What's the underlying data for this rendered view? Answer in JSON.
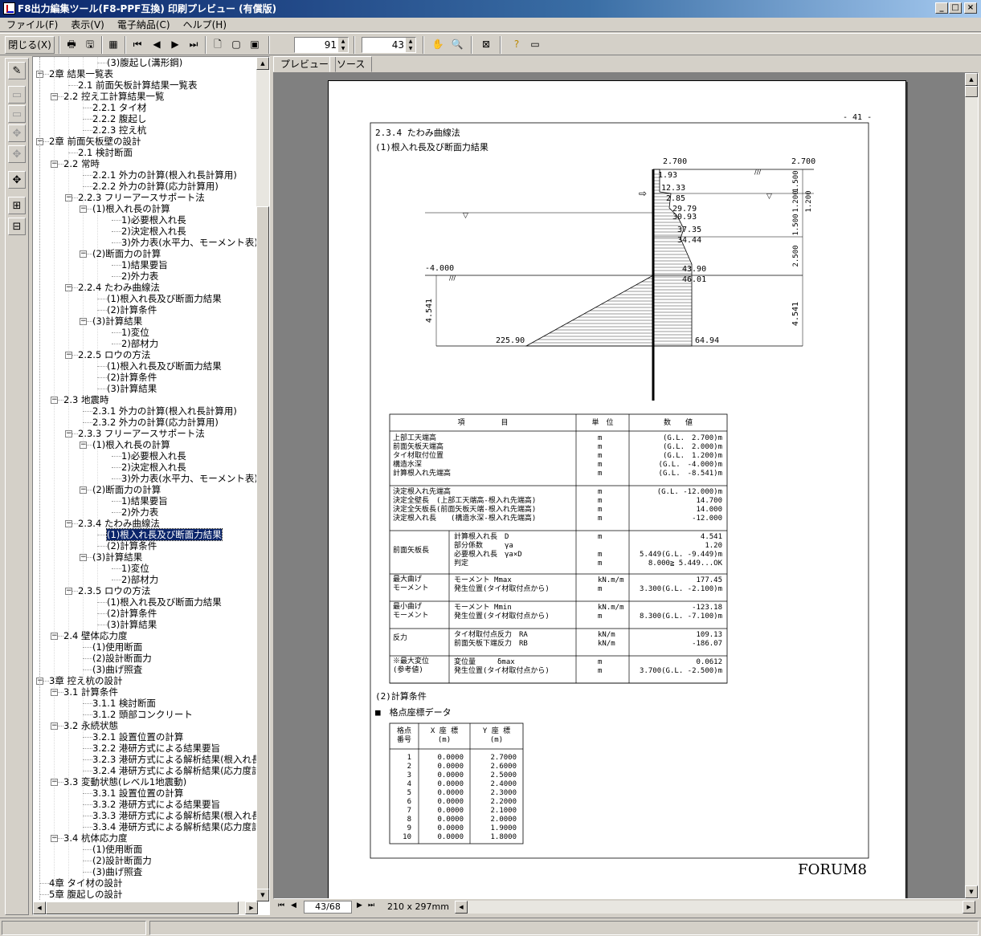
{
  "window": {
    "title": "F8出力編集ツール(F8-PPF互換) 印刷プレビュー (有償版)"
  },
  "menu": [
    "ファイル(F)",
    "表示(V)",
    "電子納品(C)",
    "ヘルプ(H)"
  ],
  "toolbar": {
    "close_label": "閉じる(X)",
    "zoom_value": "91",
    "page_value": "43"
  },
  "tabs": [
    "プレビュー",
    "ソース"
  ],
  "tree": [
    {
      "label": "(3)腹起し(溝形鋼)",
      "level": 4
    },
    {
      "label": "2章 結果一覧表",
      "level": 0
    },
    {
      "label": "2.1 前面矢板計算結果一覧表",
      "level": 2
    },
    {
      "label": "2.2 控え工計算結果一覧",
      "level": 1
    },
    {
      "label": "2.2.1 タイ材",
      "level": 3
    },
    {
      "label": "2.2.2 腹起し",
      "level": 3
    },
    {
      "label": "2.2.3 控え杭",
      "level": 3
    },
    {
      "label": "2章 前面矢板壁の設計",
      "level": 0
    },
    {
      "label": "2.1 検討断面",
      "level": 2
    },
    {
      "label": "2.2 常時",
      "level": 1
    },
    {
      "label": "2.2.1 外力の計算(根入れ長計算用)",
      "level": 3
    },
    {
      "label": "2.2.2 外力の計算(応力計算用)",
      "level": 3
    },
    {
      "label": "2.2.3 フリーアースサポート法",
      "level": 2
    },
    {
      "label": "(1)根入れ長の計算",
      "level": 3
    },
    {
      "label": "1)必要根入れ長",
      "level": 5
    },
    {
      "label": "2)決定根入れ長",
      "level": 5
    },
    {
      "label": "3)外力表(水平力、モーメント表)",
      "level": 5
    },
    {
      "label": "(2)断面力の計算",
      "level": 3
    },
    {
      "label": "1)結果要旨",
      "level": 5
    },
    {
      "label": "2)外力表",
      "level": 5
    },
    {
      "label": "2.2.4 たわみ曲線法",
      "level": 2
    },
    {
      "label": "(1)根入れ長及び断面力結果",
      "level": 4
    },
    {
      "label": "(2)計算条件",
      "level": 4
    },
    {
      "label": "(3)計算結果",
      "level": 3
    },
    {
      "label": "1)変位",
      "level": 5
    },
    {
      "label": "2)部材力",
      "level": 5
    },
    {
      "label": "2.2.5 ロウの方法",
      "level": 2
    },
    {
      "label": "(1)根入れ長及び断面力結果",
      "level": 4
    },
    {
      "label": "(2)計算条件",
      "level": 4
    },
    {
      "label": "(3)計算結果",
      "level": 4
    },
    {
      "label": "2.3 地震時",
      "level": 1
    },
    {
      "label": "2.3.1 外力の計算(根入れ長計算用)",
      "level": 3
    },
    {
      "label": "2.3.2 外力の計算(応力計算用)",
      "level": 3
    },
    {
      "label": "2.3.3 フリーアースサポート法",
      "level": 2
    },
    {
      "label": "(1)根入れ長の計算",
      "level": 3
    },
    {
      "label": "1)必要根入れ長",
      "level": 5
    },
    {
      "label": "2)決定根入れ長",
      "level": 5
    },
    {
      "label": "3)外力表(水平力、モーメント表)",
      "level": 5
    },
    {
      "label": "(2)断面力の計算",
      "level": 3
    },
    {
      "label": "1)結果要旨",
      "level": 5
    },
    {
      "label": "2)外力表",
      "level": 5
    },
    {
      "label": "2.3.4 たわみ曲線法",
      "level": 2
    },
    {
      "label": "(1)根入れ長及び断面力結果",
      "level": 4,
      "selected": true
    },
    {
      "label": "(2)計算条件",
      "level": 4
    },
    {
      "label": "(3)計算結果",
      "level": 3
    },
    {
      "label": "1)変位",
      "level": 5
    },
    {
      "label": "2)部材力",
      "level": 5
    },
    {
      "label": "2.3.5 ロウの方法",
      "level": 2
    },
    {
      "label": "(1)根入れ長及び断面力結果",
      "level": 4
    },
    {
      "label": "(2)計算条件",
      "level": 4
    },
    {
      "label": "(3)計算結果",
      "level": 4
    },
    {
      "label": "2.4 壁体応力度",
      "level": 1
    },
    {
      "label": "(1)使用断面",
      "level": 3
    },
    {
      "label": "(2)設計断面力",
      "level": 3
    },
    {
      "label": "(3)曲げ照査",
      "level": 3
    },
    {
      "label": "3章 控え杭の設計",
      "level": 0
    },
    {
      "label": "3.1 計算条件",
      "level": 1
    },
    {
      "label": "3.1.1 検討断面",
      "level": 3
    },
    {
      "label": "3.1.2 頭部コンクリート",
      "level": 3
    },
    {
      "label": "3.2 永続状態",
      "level": 1
    },
    {
      "label": "3.2.1 設置位置の計算",
      "level": 3
    },
    {
      "label": "3.2.2 港研方式による結果要旨",
      "level": 3
    },
    {
      "label": "3.2.3 港研方式による解析結果(根入れ長",
      "level": 3
    },
    {
      "label": "3.2.4 港研方式による解析結果(応力度計",
      "level": 3
    },
    {
      "label": "3.3 変動状態(レベル1地震動)",
      "level": 1
    },
    {
      "label": "3.3.1 設置位置の計算",
      "level": 3
    },
    {
      "label": "3.3.2 港研方式による結果要旨",
      "level": 3
    },
    {
      "label": "3.3.3 港研方式による解析結果(根入れ長",
      "level": 3
    },
    {
      "label": "3.3.4 港研方式による解析結果(応力度計",
      "level": 3
    },
    {
      "label": "3.4 杭体応力度",
      "level": 1
    },
    {
      "label": "(1)使用断面",
      "level": 3
    },
    {
      "label": "(2)設計断面力",
      "level": 3
    },
    {
      "label": "(3)曲げ照査",
      "level": 3
    },
    {
      "label": "4章 タイ材の設計",
      "level": 0
    },
    {
      "label": "5章 腹起しの設計",
      "level": 0
    }
  ],
  "doc": {
    "page_number": "- 41 -",
    "heading": "2.3.4 たわみ曲線法",
    "subheading": "(1)根入れ長及び断面力結果",
    "diagram": {
      "top_left_level": "2.700",
      "top_right_level": "2.700",
      "mid_left_level": "-4.000",
      "left_dim": "4.541",
      "right_dim": "4.541",
      "right_dims": [
        "1.500",
        "1.200",
        "1.500",
        "2.500"
      ],
      "pressures": [
        "1.93",
        "12.33",
        "2.85",
        "29.79",
        "30.93",
        "37.35",
        "34.44",
        "43.90",
        "46.01",
        "225.90",
        "64.94"
      ]
    },
    "results_table": {
      "headers": [
        "項　　　　　目",
        "単　位",
        "数　　値"
      ],
      "group1": {
        "items": [
          "上部工天端高",
          "前面矢板天端高",
          "タイ材取付位置",
          "構造水深",
          "計算根入れ先端高"
        ],
        "units": [
          "m",
          "m",
          "m",
          "m",
          "m"
        ],
        "values": [
          "(G.L.　2.700)m",
          "(G.L.　2.000)m",
          "(G.L.　1.200)m",
          "(G.L.　-4.000)m",
          "(G.L.　-8.541)m"
        ]
      },
      "group2": {
        "items": [
          "決定根入れ先端高",
          "決定全壁長　(上部工天端高-根入れ先端高)",
          "決定全矢板長(前面矢板天端-根入れ先端高)",
          "決定根入れ長　　(構造水深-根入れ先端高)"
        ],
        "units": [
          "m",
          "m",
          "m",
          "m"
        ],
        "values": [
          "(G.L. -12.000)m",
          "14.700",
          "14.000",
          "-12.000"
        ]
      },
      "group3": {
        "label": "前面矢板長",
        "items": [
          "計算根入れ長　D",
          "部分係数　　　γa",
          "必要根入れ長　γa×D",
          "判定"
        ],
        "units": [
          "m",
          "",
          "m",
          "m"
        ],
        "values": [
          "4.541",
          "1.20",
          "5.449(G.L. -9.449)m",
          "8.000≧ 5.449...OK"
        ]
      },
      "group4": {
        "label": [
          "最大曲げ",
          "モーメント"
        ],
        "items": [
          "モーメント Mmax",
          "発生位置(タイ材取付点から)"
        ],
        "units": [
          "kN.m/m",
          "m"
        ],
        "values": [
          "177.45",
          "3.300(G.L. -2.100)m"
        ]
      },
      "group5": {
        "label": [
          "最小曲げ",
          "モーメント"
        ],
        "items": [
          "モーメント Mmin",
          "発生位置(タイ材取付点から)"
        ],
        "units": [
          "kN.m/m",
          "m"
        ],
        "values": [
          "-123.18",
          "8.300(G.L. -7.100)m"
        ]
      },
      "group6": {
        "label": [
          "反力"
        ],
        "items": [
          "タイ材取付点反力　RA",
          "前面矢板下端反力　RB"
        ],
        "units": [
          "kN/m",
          "kN/m"
        ],
        "values": [
          "109.13",
          "-186.07"
        ]
      },
      "group7": {
        "label": [
          "※最大変位",
          "(参考値)"
        ],
        "items": [
          "変位量　　　δmax",
          "発生位置(タイ材取付点から)"
        ],
        "units": [
          "m",
          "m"
        ],
        "values": [
          "0.0612",
          "3.700(G.L. -2.500)m"
        ]
      }
    },
    "section2": "(2)計算条件",
    "section2_sub": "■　格点座標データ",
    "coord_table": {
      "headers": [
        [
          "格点",
          "番号"
        ],
        [
          "X 座 標",
          "(m)"
        ],
        [
          "Y 座 標",
          "(m)"
        ]
      ],
      "rows": [
        [
          "1",
          "0.0000",
          "2.7000"
        ],
        [
          "2",
          "0.0000",
          "2.6000"
        ],
        [
          "3",
          "0.0000",
          "2.5000"
        ],
        [
          "4",
          "0.0000",
          "2.4000"
        ],
        [
          "5",
          "0.0000",
          "2.3000"
        ],
        [
          "6",
          "0.0000",
          "2.2000"
        ],
        [
          "7",
          "0.0000",
          "2.1000"
        ],
        [
          "8",
          "0.0000",
          "2.0000"
        ],
        [
          "9",
          "0.0000",
          "1.9000"
        ],
        [
          "10",
          "0.0000",
          "1.8000"
        ]
      ]
    },
    "footer_logo": "FORUM8"
  },
  "navbar": {
    "page_indicator": "43/68",
    "paper_size": "210 x 297mm"
  }
}
